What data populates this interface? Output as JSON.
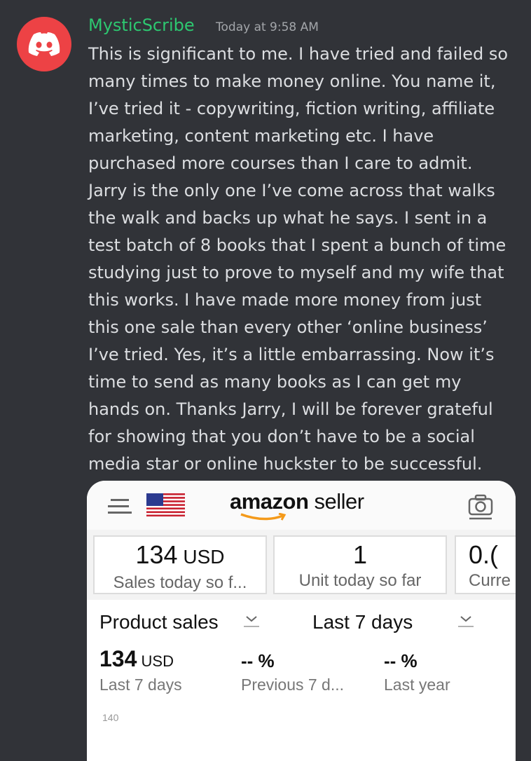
{
  "author": {
    "name": "MysticScribe",
    "timestamp": "Today at 9:58 AM",
    "avatar_icon": "discord-logo-icon",
    "avatar_color": "#ed4245",
    "name_color": "#2dc770"
  },
  "message": {
    "text": "This is significant to me. I have tried and failed so\nmany times to make money online. You name it,\nI’ve tried it - copywriting, fiction writing, affiliate\nmarketing, content marketing etc. I have\npurchased more courses than I care to admit.\nJarry is the only one I’ve come across that walks\nthe walk and backs up what he says. I sent in a\ntest batch of 8 books that I spent a bunch of time\nstudying just to prove to myself and my wife that\nthis works. I have made more money from just\nthis one sale than every other ‘online business’\nI’ve tried. Yes, it’s a little embarrassing. Now it’s\ntime to send as many books as I can get my\nhands on. Thanks Jarry, I will be forever grateful\nfor showing that you don’t have to be a social\nmedia star or online huckster to be successful."
  },
  "attachment": {
    "header": {
      "logo_bold": "amazon",
      "logo_light": " seller",
      "menu_icon": "hamburger-icon",
      "flag_icon": "us-flag-icon",
      "camera_icon": "camera-icon"
    },
    "metrics": [
      {
        "value": "134",
        "unit": " USD",
        "label": "Sales today so f..."
      },
      {
        "value": "1",
        "unit": "",
        "label": "Unit today so far"
      },
      {
        "value": "0.(",
        "unit": "",
        "label": "Curre"
      }
    ],
    "selectors": {
      "left": "Product sales",
      "right": "Last 7 days"
    },
    "summary": [
      {
        "value": "134",
        "unit": " USD",
        "label": "Last 7 days"
      },
      {
        "value": "-- %",
        "unit": "",
        "label": "Previous 7 d..."
      },
      {
        "value": "-- %",
        "unit": "",
        "label": "Last year"
      }
    ],
    "axis_top": "140"
  }
}
